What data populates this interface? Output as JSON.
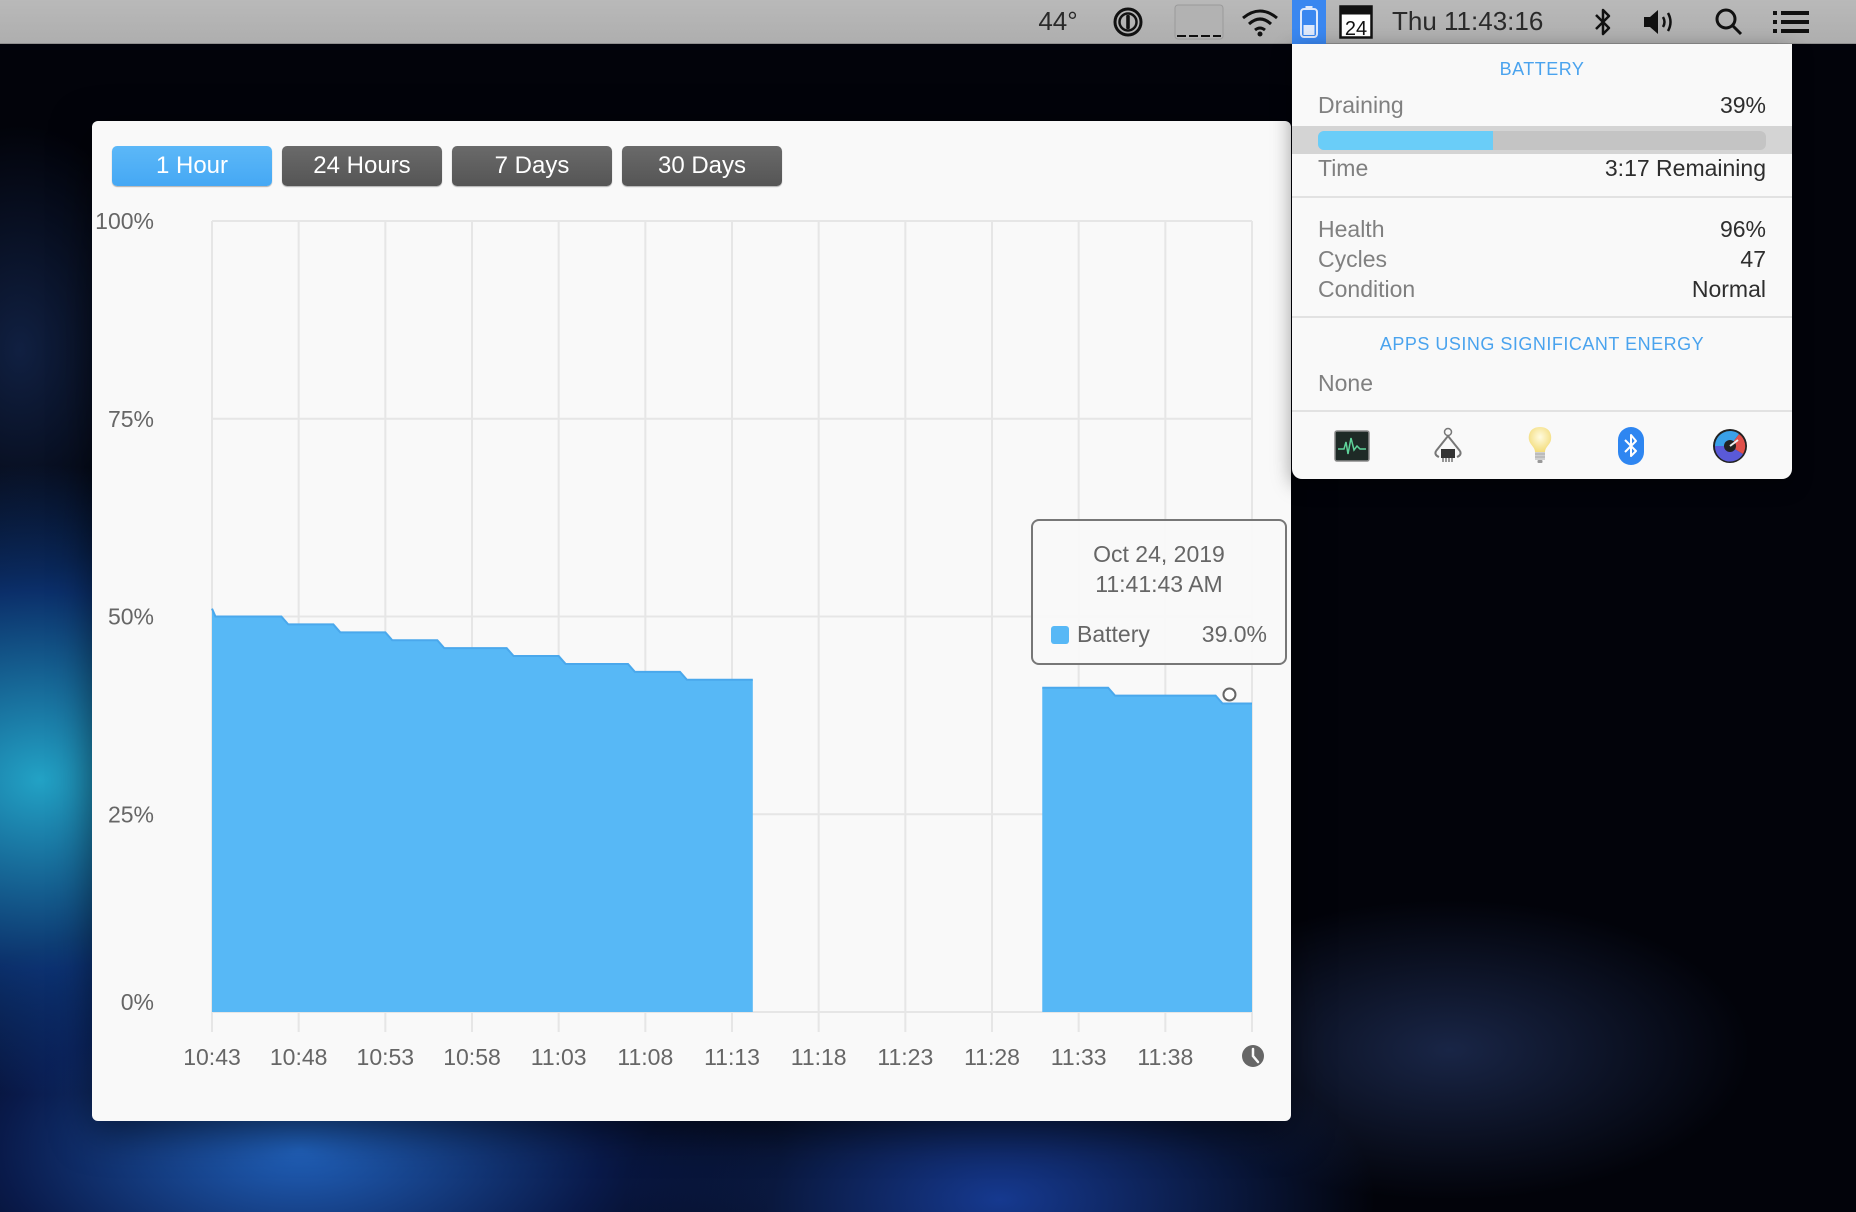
{
  "menubar": {
    "temperature": "44°",
    "password_icon": "1password-icon",
    "blank_item_icon": "blank-box-icon",
    "wifi_icon": "wifi-icon",
    "battery_icon": "battery-icon",
    "calendar_day": "24",
    "clock": "Thu 11:43:16",
    "bluetooth_icon": "bluetooth-icon",
    "volume_icon": "volume-icon",
    "spotlight_icon": "search-icon",
    "notification_icon": "list-icon"
  },
  "chart_window": {
    "ranges": [
      {
        "label": "1 Hour",
        "active": true
      },
      {
        "label": "24 Hours",
        "active": false
      },
      {
        "label": "7 Days",
        "active": false
      },
      {
        "label": "30 Days",
        "active": false
      }
    ],
    "clock_icon": "clock-icon"
  },
  "tooltip": {
    "date": "Oct 24, 2019",
    "time": "11:41:43 AM",
    "series": "Battery",
    "value": "39.0%"
  },
  "chart_data": {
    "type": "area",
    "title": "",
    "xlabel": "",
    "ylabel": "",
    "ylim": [
      0,
      100
    ],
    "x_unit": "minutes since 10:43",
    "xlim": [
      0,
      60
    ],
    "y_ticks": [
      "0%",
      "25%",
      "50%",
      "75%",
      "100%"
    ],
    "y_tick_values": [
      0,
      25,
      50,
      75,
      100
    ],
    "x_ticks": [
      "10:43",
      "10:48",
      "10:53",
      "10:58",
      "11:03",
      "11:08",
      "11:13",
      "11:18",
      "11:23",
      "11:28",
      "11:33",
      "11:38"
    ],
    "x_tick_values": [
      0,
      5,
      10,
      15,
      20,
      25,
      30,
      35,
      40,
      45,
      50,
      55
    ],
    "grid": true,
    "color": "#57b8f6",
    "series": [
      {
        "name": "Battery",
        "segments": [
          {
            "points": [
              [
                0,
                51
              ],
              [
                0.2,
                50
              ],
              [
                4,
                50
              ],
              [
                4.4,
                49
              ],
              [
                7,
                49
              ],
              [
                7.4,
                48
              ],
              [
                10,
                48
              ],
              [
                10.4,
                47
              ],
              [
                13,
                47
              ],
              [
                13.4,
                46
              ],
              [
                17,
                46
              ],
              [
                17.4,
                45
              ],
              [
                20,
                45
              ],
              [
                20.4,
                44
              ],
              [
                24,
                44
              ],
              [
                24.4,
                43
              ],
              [
                27,
                43
              ],
              [
                27.4,
                42
              ],
              [
                31.2,
                42
              ]
            ]
          },
          {
            "points": [
              [
                47.9,
                41
              ],
              [
                51.7,
                41
              ],
              [
                52.1,
                40
              ],
              [
                57.9,
                40
              ],
              [
                58.3,
                39
              ],
              [
                60,
                39
              ]
            ]
          }
        ]
      }
    ],
    "hover_point": {
      "x": 58.7,
      "y": 39.0,
      "label": "11:41:43 AM"
    }
  },
  "popover": {
    "title": "BATTERY",
    "status_label": "Draining",
    "status_value": "39%",
    "charge_fraction": 0.39,
    "time_label": "Time",
    "time_value": "3:17 Remaining",
    "health_label": "Health",
    "health_value": "96%",
    "cycles_label": "Cycles",
    "cycles_value": "47",
    "condition_label": "Condition",
    "condition_value": "Normal",
    "apps_heading": "APPS USING SIGNIFICANT ENERGY",
    "apps_value": "None",
    "accent_color": "#4aa3ee",
    "bar_color": "#6acdf8",
    "footer_icons": [
      "activity-monitor-icon",
      "system-information-icon",
      "light-bulb-icon",
      "bluetooth-app-icon",
      "istat-gauge-icon"
    ]
  }
}
